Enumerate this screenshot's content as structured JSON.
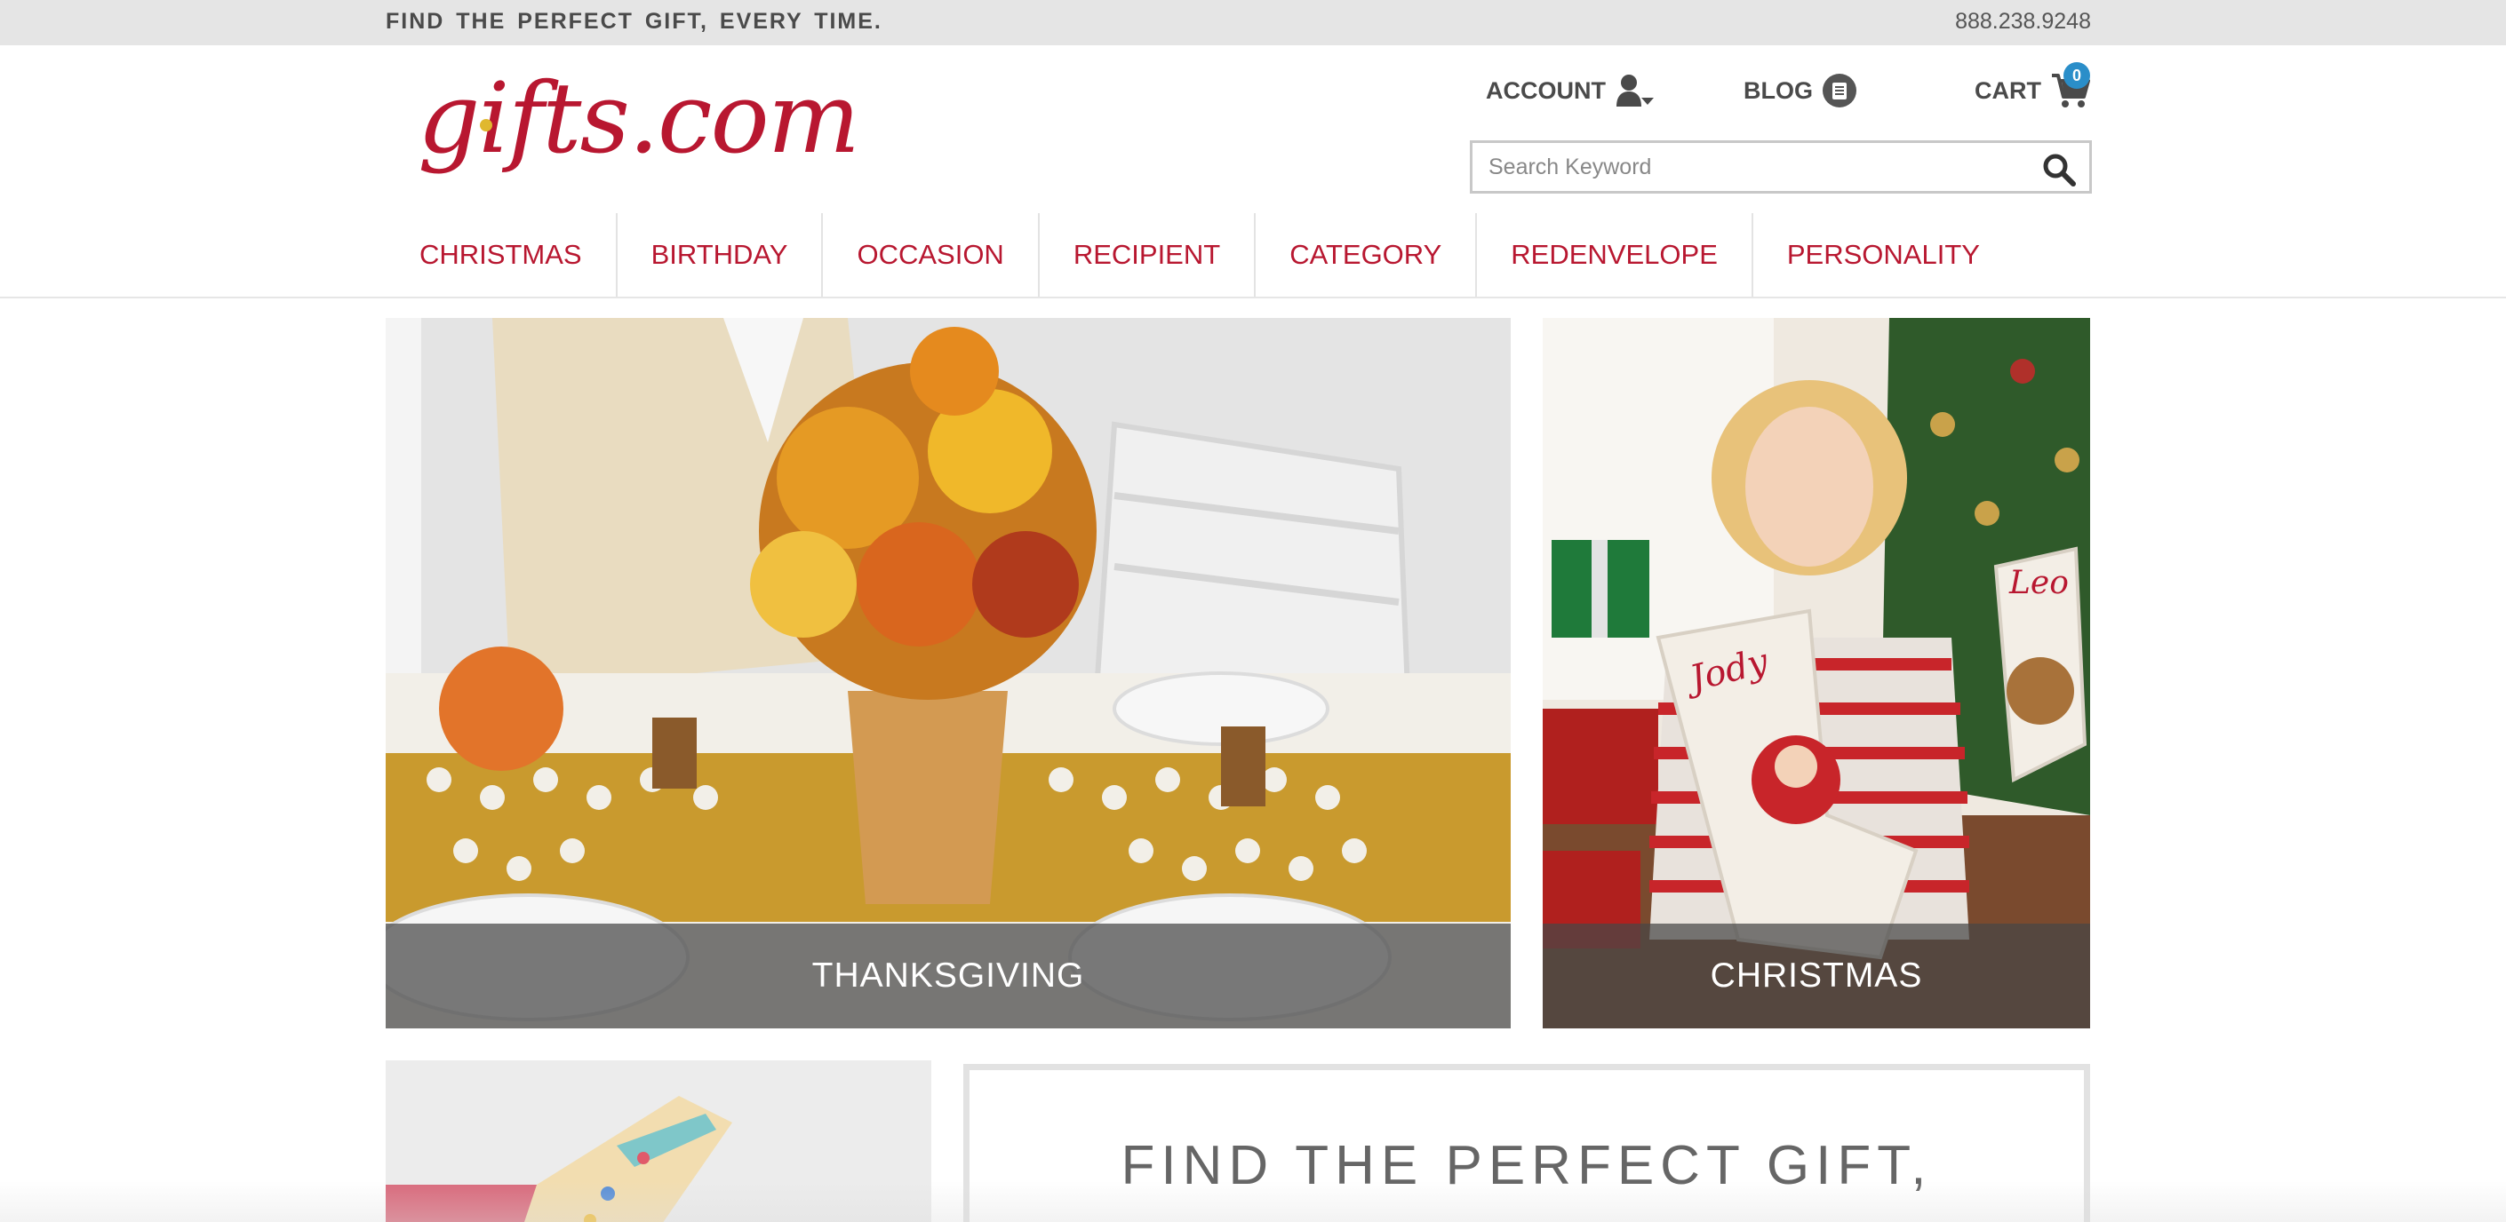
{
  "topbar": {
    "tagline": "FIND THE PERFECT GIFT, EVERY TIME.",
    "phone": "888.238.9248"
  },
  "header": {
    "logo_text": "gifts.com",
    "account_label": "ACCOUNT",
    "blog_label": "BLOG",
    "cart_label": "CART",
    "cart_count": "0",
    "search_placeholder": "Search Keyword"
  },
  "nav": {
    "items": [
      "CHRISTMAS",
      "BIRTHDAY",
      "OCCASION",
      "RECIPIENT",
      "CATEGORY",
      "REDENVELOPE",
      "PERSONALITY"
    ]
  },
  "hero": {
    "left_caption": "THANKSGIVING",
    "right_caption": "CHRISTMAS",
    "stocking_name_1": "Jody",
    "stocking_name_2": "Leo"
  },
  "promo": {
    "headline": "FIND THE PERFECT GIFT,"
  },
  "colors": {
    "brand_red": "#b81730",
    "logo_dot": "#e0b82f",
    "cart_badge": "#2a8ec9",
    "topbar_bg": "#e5e5e5"
  },
  "icons": {
    "account": "user-dropdown-icon",
    "blog": "list-circle-icon",
    "cart": "shopping-cart-icon",
    "search": "magnifier-icon"
  }
}
